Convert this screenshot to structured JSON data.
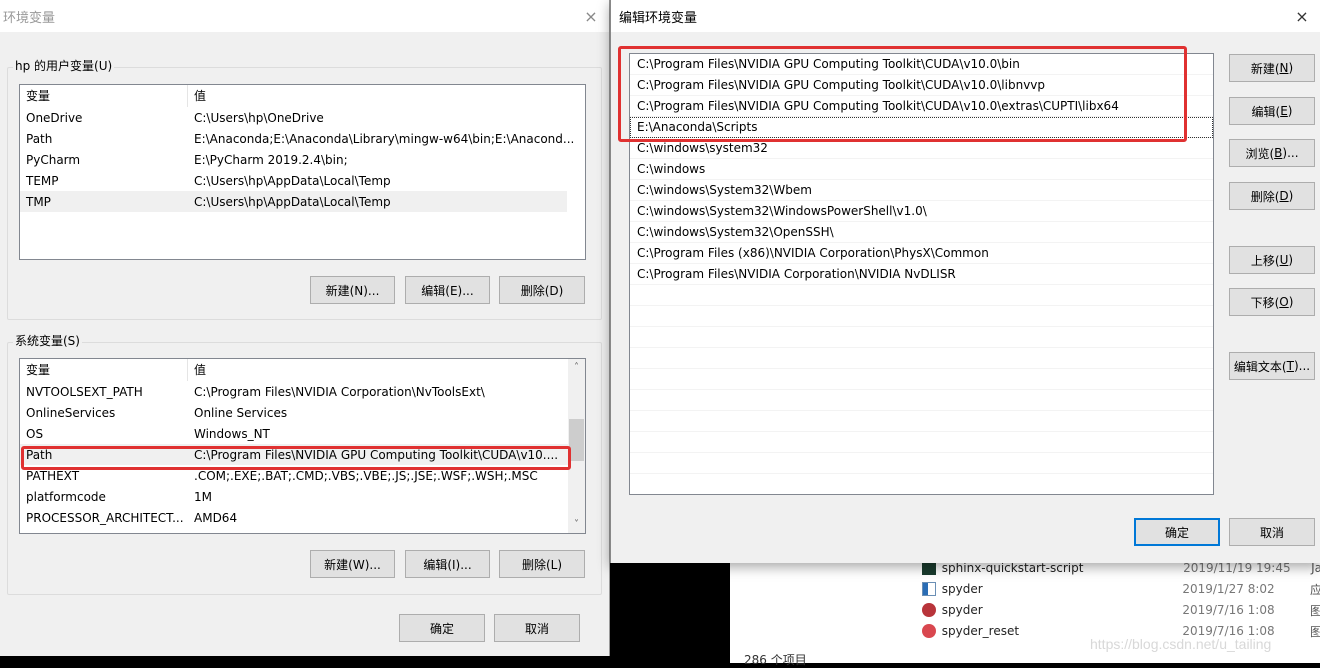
{
  "env_dialog": {
    "title": "环境变量",
    "close_icon": "×",
    "user_vars": {
      "group_label": "hp 的用户变量(U)",
      "columns": [
        "变量",
        "值"
      ],
      "rows": [
        {
          "name": "OneDrive",
          "value": "C:\\Users\\hp\\OneDrive"
        },
        {
          "name": "Path",
          "value": "E:\\Anaconda;E:\\Anaconda\\Library\\mingw-w64\\bin;E:\\Anacond..."
        },
        {
          "name": "PyCharm",
          "value": "E:\\PyCharm 2019.2.4\\bin;"
        },
        {
          "name": "TEMP",
          "value": "C:\\Users\\hp\\AppData\\Local\\Temp"
        },
        {
          "name": "TMP",
          "value": "C:\\Users\\hp\\AppData\\Local\\Temp"
        }
      ],
      "buttons": {
        "new": "新建(N)...",
        "edit": "编辑(E)...",
        "delete": "删除(D)"
      }
    },
    "system_vars": {
      "group_label": "系统变量(S)",
      "columns": [
        "变量",
        "值"
      ],
      "rows": [
        {
          "name": "NVTOOLSEXT_PATH",
          "value": "C:\\Program Files\\NVIDIA Corporation\\NvToolsExt\\"
        },
        {
          "name": "OnlineServices",
          "value": "Online Services"
        },
        {
          "name": "OS",
          "value": "Windows_NT"
        },
        {
          "name": "Path",
          "value": "C:\\Program Files\\NVIDIA GPU Computing Toolkit\\CUDA\\v10...."
        },
        {
          "name": "PATHEXT",
          "value": ".COM;.EXE;.BAT;.CMD;.VBS;.VBE;.JS;.JSE;.WSF;.WSH;.MSC"
        },
        {
          "name": "platformcode",
          "value": "1M"
        },
        {
          "name": "PROCESSOR_ARCHITECT...",
          "value": "AMD64"
        }
      ],
      "scroll_up_icon": "˄",
      "scroll_down_icon": "˅",
      "buttons": {
        "new": "新建(W)...",
        "edit": "编辑(I)...",
        "delete": "删除(L)"
      }
    },
    "ok": "确定",
    "cancel": "取消"
  },
  "edit_dialog": {
    "title": "编辑环境变量",
    "close_icon": "×",
    "paths": [
      "C:\\Program Files\\NVIDIA GPU Computing Toolkit\\CUDA\\v10.0\\bin",
      "C:\\Program Files\\NVIDIA GPU Computing Toolkit\\CUDA\\v10.0\\libnvvp",
      "C:\\Program Files\\NVIDIA GPU Computing Toolkit\\CUDA\\v10.0\\extras\\CUPTI\\libx64",
      "E:\\Anaconda\\Scripts",
      "C:\\windows\\system32",
      "C:\\windows",
      "C:\\windows\\System32\\Wbem",
      "C:\\windows\\System32\\WindowsPowerShell\\v1.0\\",
      "C:\\windows\\System32\\OpenSSH\\",
      "C:\\Program Files (x86)\\NVIDIA Corporation\\PhysX\\Common",
      "C:\\Program Files\\NVIDIA Corporation\\NVIDIA NvDLISR"
    ],
    "buttons": {
      "new": {
        "text": "新建(",
        "key": "N",
        "end": ")"
      },
      "edit": {
        "text": "编辑(",
        "key": "E",
        "end": ")"
      },
      "browse": {
        "text": "浏览(",
        "key": "B",
        "end": ")..."
      },
      "delete": {
        "text": "删除(",
        "key": "D",
        "end": ")"
      },
      "move_up": {
        "text": "上移(",
        "key": "U",
        "end": ")"
      },
      "move_down": {
        "text": "下移(",
        "key": "O",
        "end": ")"
      },
      "edit_text": {
        "text": "编辑文本(",
        "key": "T",
        "end": ")..."
      }
    },
    "ok": "确定",
    "cancel": "取消"
  },
  "explorer": {
    "files": [
      {
        "name": "sphinx-quickstart-script",
        "date": "2019/11/19 19:45",
        "type": "Ja",
        "icon": "pycharm-icon"
      },
      {
        "name": "spyder",
        "date": "2019/1/27 8:02",
        "type": "应",
        "icon": "app-icon"
      },
      {
        "name": "spyder",
        "date": "2019/7/16 1:08",
        "type": "图",
        "icon": "spyder-icon"
      },
      {
        "name": "spyder_reset",
        "date": "2019/7/16 1:08",
        "type": "图",
        "icon": "spyder-icon"
      }
    ],
    "item_count": "286 个项目"
  },
  "watermark": "https://blog.csdn.net/u_tailing"
}
